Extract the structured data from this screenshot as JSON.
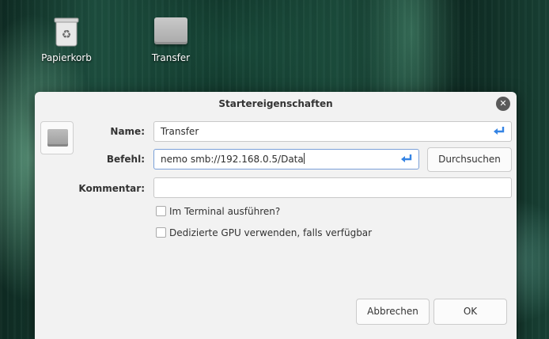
{
  "desktop": {
    "icons": [
      {
        "label": "Papierkorb",
        "icon": "trash-icon"
      },
      {
        "label": "Transfer",
        "icon": "folder-icon"
      }
    ]
  },
  "dialog": {
    "title": "Startereigenschaften",
    "close_icon": "close-icon",
    "name": {
      "label": "Name:",
      "value": "Transfer"
    },
    "command": {
      "label": "Befehl:",
      "value": "nemo smb://192.168.0.5/Data",
      "browse_label": "Durchsuchen"
    },
    "comment": {
      "label": "Kommentar:",
      "value": ""
    },
    "run_in_terminal": {
      "label": "Im Terminal ausführen?",
      "checked": false
    },
    "dedicated_gpu": {
      "label": "Dedizierte GPU verwenden, falls verfügbar",
      "checked": false
    },
    "cancel_label": "Abbrechen",
    "ok_label": "OK"
  },
  "colors": {
    "accent": "#3584e4",
    "close_button": "#5a5a5a"
  }
}
